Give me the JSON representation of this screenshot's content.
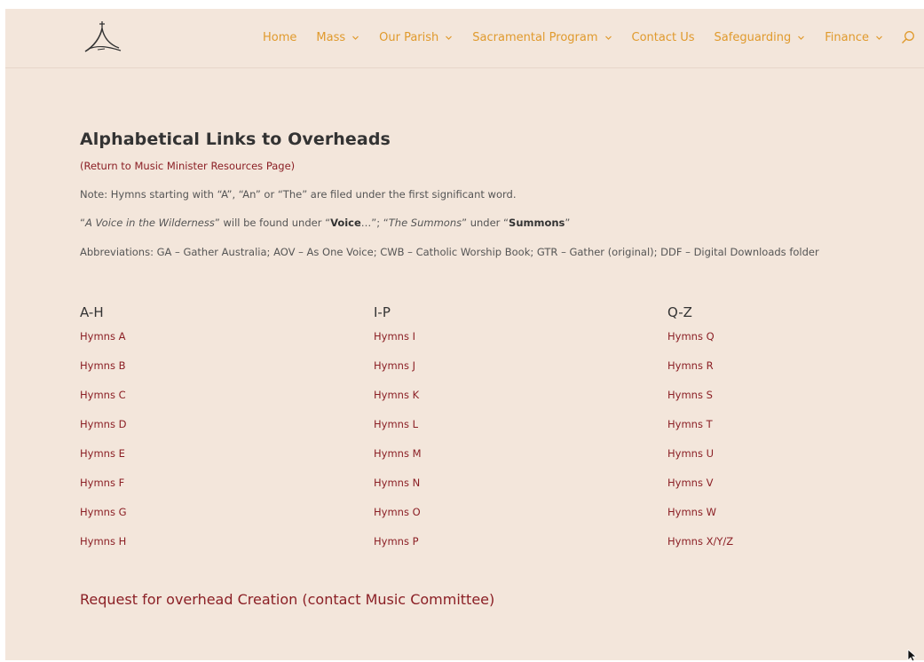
{
  "nav": {
    "items": [
      {
        "label": "Home",
        "dropdown": false
      },
      {
        "label": "Mass",
        "dropdown": true
      },
      {
        "label": "Our Parish",
        "dropdown": true
      },
      {
        "label": "Sacramental Program",
        "dropdown": true
      },
      {
        "label": "Contact Us",
        "dropdown": false
      },
      {
        "label": "Safeguarding",
        "dropdown": true
      },
      {
        "label": "Finance",
        "dropdown": true
      }
    ]
  },
  "colors": {
    "page_bg": "#f3e6db",
    "nav_text": "#e09a2d",
    "link": "#8b1f25",
    "heading": "#333333",
    "body_text": "#555555"
  },
  "icons": {
    "logo": "cross-tent-logo",
    "search": "search-icon",
    "chevron": "chevron-down-icon"
  },
  "main": {
    "title": "Alphabetical Links to Overheads",
    "return_link": "(Return to Music Minister Resources Page)",
    "note": "Note: Hymns starting with “A”, “An” or “The” are filed under the first significant word.",
    "voice": {
      "q1": "“",
      "title1": "A Voice in the Wilderness",
      "t1": "” will be found under “",
      "bold1": "Voice",
      "t2": "…”; “",
      "title2": "The Summons",
      "t3": "” under “",
      "bold2": "Summons",
      "t4": "”"
    },
    "abbreviations": "Abbreviations: GA – Gather Australia; AOV – As One Voice; CWB – Catholic Worship Book; GTR – Gather (original); DDF – Digital Downloads folder"
  },
  "columns": [
    {
      "heading": "A-H",
      "links": [
        "Hymns A",
        "Hymns B",
        "Hymns C",
        "Hymns D",
        "Hymns E",
        "Hymns F",
        "Hymns G",
        "Hymns H"
      ]
    },
    {
      "heading": "I-P",
      "links": [
        "Hymns I",
        "Hymns J",
        "Hymns K",
        "Hymns L",
        "Hymns M",
        "Hymns N",
        "Hymns O",
        "Hymns P"
      ]
    },
    {
      "heading": "Q-Z",
      "links": [
        "Hymns Q",
        "Hymns R",
        "Hymns S",
        "Hymns T",
        "Hymns U",
        "Hymns V",
        "Hymns W",
        "Hymns X/Y/Z"
      ]
    }
  ],
  "request_link": "Request for overhead Creation (contact Music Committee)"
}
